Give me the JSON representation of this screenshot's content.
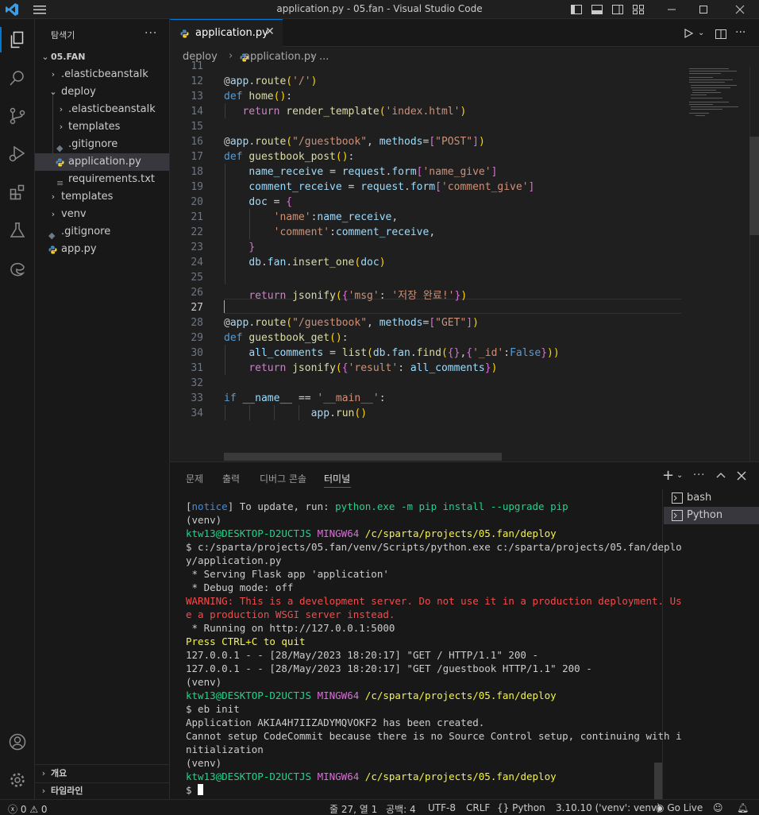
{
  "window": {
    "title": "application.py - 05.fan - Visual Studio Code"
  },
  "sidebar": {
    "title": "탐색기",
    "root": "05.FAN",
    "items": [
      {
        "label": ".elasticbeanstalk",
        "type": "folder",
        "expanded": false
      },
      {
        "label": "deploy",
        "type": "folder",
        "expanded": true
      },
      {
        "label": ".elasticbeanstalk",
        "type": "folder",
        "expanded": false
      },
      {
        "label": "templates",
        "type": "folder",
        "expanded": false
      },
      {
        "label": ".gitignore",
        "type": "file"
      },
      {
        "label": "application.py",
        "type": "python",
        "selected": true
      },
      {
        "label": "requirements.txt",
        "type": "text"
      },
      {
        "label": "templates",
        "type": "folder",
        "expanded": false
      },
      {
        "label": "venv",
        "type": "folder",
        "expanded": false
      },
      {
        "label": ".gitignore",
        "type": "file"
      },
      {
        "label": "app.py",
        "type": "python"
      }
    ],
    "outline": "개요",
    "timeline": "타임라인"
  },
  "editor": {
    "tab_label": "application.py",
    "breadcrumb": [
      "deploy",
      "application.py",
      "..."
    ],
    "line_numbers": [
      "11",
      "12",
      "13",
      "14",
      "15",
      "16",
      "17",
      "18",
      "19",
      "20",
      "21",
      "22",
      "23",
      "24",
      "25",
      "26",
      "27",
      "28",
      "29",
      "30",
      "31",
      "32",
      "33",
      "34"
    ],
    "lines": [
      "",
      "@app.route('/')",
      "def home():",
      "   return render_template('index.html')",
      "",
      "@app.route(\"/guestbook\", methods=[\"POST\"])",
      "def guestbook_post():",
      "    name_receive = request.form['name_give']",
      "    comment_receive = request.form['comment_give']",
      "    doc = {",
      "        'name':name_receive,",
      "        'comment':comment_receive,",
      "    }",
      "    db.fan.insert_one(doc)",
      "",
      "    return jsonify({'msg': '저장 완료!'})",
      "",
      "@app.route(\"/guestbook\", methods=[\"GET\"])",
      "def guestbook_get():",
      "    all_comments = list(db.fan.find({},{'_id':False}))",
      "    return jsonify({'result': all_comments})",
      "",
      "if __name__ == '__main__':",
      "              app.run()"
    ],
    "current_line": "27"
  },
  "panel": {
    "tabs": [
      "문제",
      "출력",
      "디버그 콘솔",
      "터미널"
    ],
    "active_tab": "터미널",
    "terminals": [
      "bash",
      "Python"
    ],
    "active_terminal": "Python",
    "lines": {
      "l1_a": "[",
      "l1_b": "notice",
      "l1_c": "] To update, run: ",
      "l1_d": "python.exe -m pip install --upgrade pip",
      "venv": "(venv)",
      "prompt_user": "ktw13@DESKTOP-D2UCTJS",
      "prompt_env": "MINGW64",
      "prompt_path": "/c/sparta/projects/05.fan/deploy",
      "cmd1a": "$ c:/sparta/projects/05.fan/venv/Scripts/python.exe c:/sparta/projects/05.fan/deplo",
      "cmd1b": "y/application.py",
      "serving": " * Serving Flask app 'application'",
      "debug": " * Debug mode: off",
      "warn1": "WARNING: This is a development server. Do not use it in a production deployment. Us",
      "warn2": "e a production WSGI server instead.",
      "running": " * Running on http://127.0.0.1:5000",
      "quit": "Press CTRL+C to quit",
      "req1": "127.0.0.1 - - [28/May/2023 18:20:17] \"GET / HTTP/1.1\" 200 -",
      "req2": "127.0.0.1 - - [28/May/2023 18:20:17] \"GET /guestbook HTTP/1.1\" 200 -",
      "cmd2": "$ eb init",
      "created": "Application AKIA4H7IIZADYMQVOKF2 has been created.",
      "cannot1": "Cannot setup CodeCommit because there is no Source Control setup, continuing with i",
      "cannot2": "nitialization",
      "dollar": "$ "
    }
  },
  "statusbar": {
    "errors": "0",
    "warnings": "0",
    "position": "줄 27, 열 1",
    "spaces": "공백: 4",
    "encoding": "UTF-8",
    "eol": "CRLF",
    "language": "Python",
    "interpreter": "3.10.10 ('venv': venv)",
    "golive": "Go Live"
  },
  "colors": {
    "accent": "#0078d4",
    "vscode_blue": "#3b9ee8",
    "python_blue": "#4b8bbe",
    "python_yellow": "#ffd43b"
  }
}
